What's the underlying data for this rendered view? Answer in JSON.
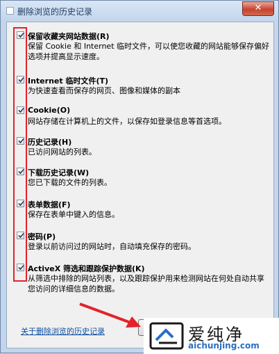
{
  "window": {
    "title": "删除浏览的历史记录",
    "close_label": "✕"
  },
  "options": [
    {
      "title": "保留收藏夹网站数据(R)",
      "desc": "保留 Cookie 和 Internet 临时文件，可以使您收藏的网站能够保存偏好选项并提高显示速度。",
      "checked": true
    },
    {
      "title": "Internet 临时文件(T)",
      "desc": "为快速查看而保存的网页、图像和媒体的副本",
      "checked": true
    },
    {
      "title": "Cookie(O)",
      "desc": "网站存储在计算机上的文件，以保存如登录信息等首选项。",
      "checked": true
    },
    {
      "title": "历史记录(H)",
      "desc": "已访问网站的列表。",
      "checked": true
    },
    {
      "title": "下载历史记录(W)",
      "desc": "您已下载的文件的列表。",
      "checked": true
    },
    {
      "title": "表单数据(F)",
      "desc": "保存在表单中键入的信息。",
      "checked": true
    },
    {
      "title": "密码(P)",
      "desc": "登录以前访问过的网站时，自动填充保存的密码。",
      "checked": true
    },
    {
      "title": "ActiveX 筛选和跟踪保护数据(K)",
      "desc": "从筛选中排除的网站列表，以及跟踪保护用来检测网站在何处自动共享您访问的详细信息的数据。",
      "checked": true
    }
  ],
  "footer": {
    "link_text": "关于删除浏览的历史记录"
  },
  "watermark": {
    "name": "爱纯净",
    "url": "aichunjing.com"
  },
  "colors": {
    "highlight": "#e3222a",
    "link": "#0b4fa3"
  }
}
